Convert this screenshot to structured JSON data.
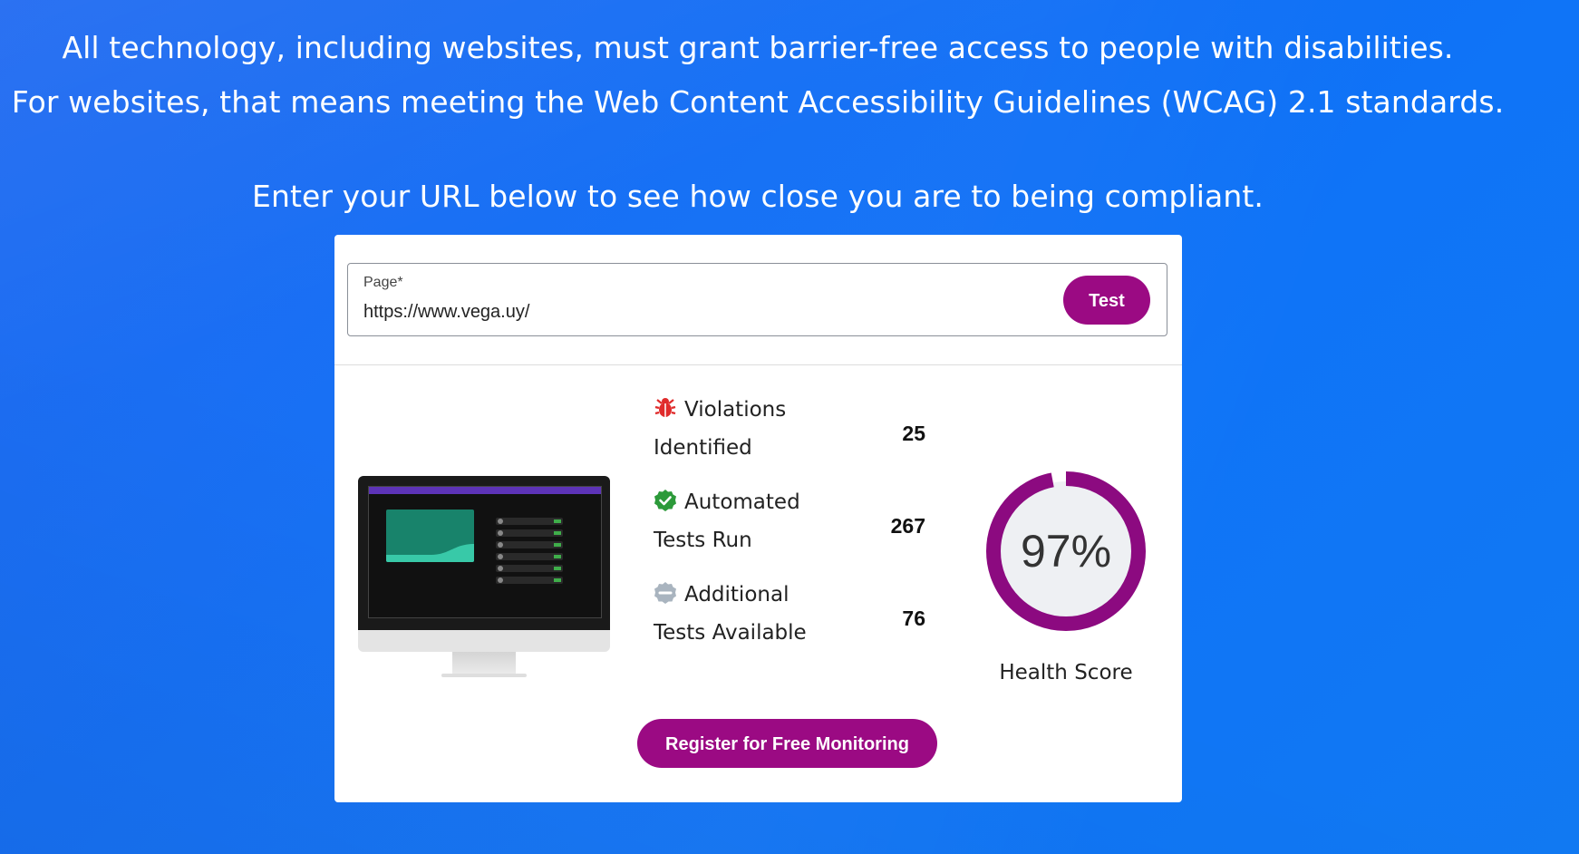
{
  "intro": {
    "line1": "All technology, including websites, must grant barrier-free access to people with disabilities.",
    "line2": "For websites, that means meeting the Web Content Accessibility Guidelines (WCAG) 2.1 standards.",
    "line3": "Enter your URL below to see how close you are to being compliant."
  },
  "form": {
    "field_label": "Page",
    "required_mark": "*",
    "field_value": "https://www.vega.uy/",
    "test_button": "Test"
  },
  "stats": [
    {
      "label_line1": "Violations",
      "label_line2": "Identified",
      "value": "25",
      "icon": "bug-icon",
      "color": "#e02b2b"
    },
    {
      "label_line1": "Automated",
      "label_line2": "Tests Run",
      "value": "267",
      "icon": "check-circle-icon",
      "color": "#2c9a3a"
    },
    {
      "label_line1": "Additional",
      "label_line2": "Tests Available",
      "value": "76",
      "icon": "minus-circle-icon",
      "color": "#a9b4bf"
    }
  ],
  "health": {
    "score_text": "97%",
    "score_fraction": 0.97,
    "label": "Health Score",
    "color": "#8c0a80"
  },
  "register_button": "Register for Free Monitoring",
  "colors": {
    "background": "#0f6cf5",
    "accent": "#9b0a83"
  }
}
